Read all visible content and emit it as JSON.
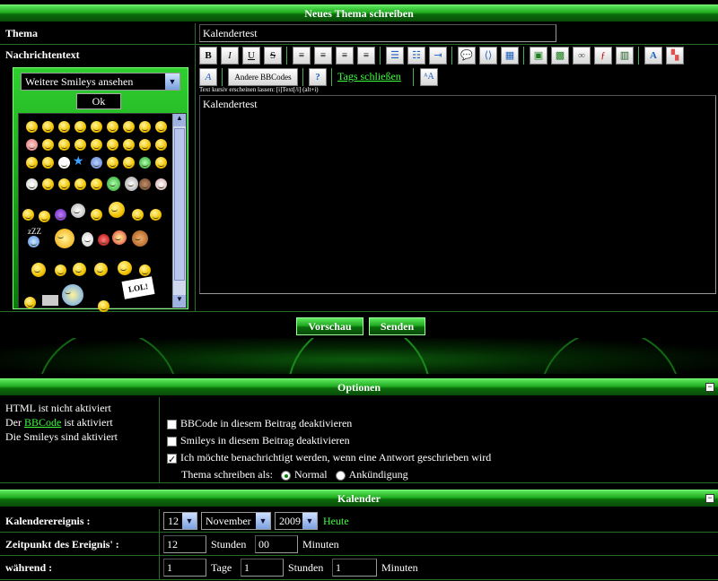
{
  "header": {
    "title": "Neues Thema schreiben"
  },
  "thema": {
    "label": "Thema",
    "value": "Kalendertest"
  },
  "message": {
    "label": "Nachrichtentext",
    "smiley_select": "Weitere Smileys ansehen",
    "ok_label": "Ok",
    "toolbar": {
      "bold": "B",
      "italic": "I",
      "underline": "U",
      "strike": "S",
      "more_bbcodes": "Andere BBCodes",
      "help": "?",
      "close_tags": "Tags schließen"
    },
    "hint": "Text kursiv erscheinen lassen: [i]Text[/i] (alt+i)",
    "body": "Kalendertest"
  },
  "actions": {
    "preview": "Vorschau",
    "send": "Senden"
  },
  "options": {
    "title": "Optionen",
    "toggle": "−",
    "html_status": "HTML ist nicht aktiviert",
    "bbcode_prefix": "Der",
    "bbcode_link": "BBCode",
    "bbcode_suffix": "ist aktiviert",
    "smileys_status": "Die Smileys sind aktiviert",
    "disable_bbcode": "BBCode in diesem Beitrag deaktivieren",
    "disable_smileys": "Smileys in diesem Beitrag deaktivieren",
    "notify": "Ich möchte benachrichtigt werden, wenn eine Antwort geschrieben wird",
    "post_as_label": "Thema schreiben als:",
    "post_as_normal": "Normal",
    "post_as_announcement": "Ankündigung"
  },
  "calendar": {
    "title": "Kalender",
    "toggle": "−",
    "event_label": "Kalenderereignis :",
    "day": "12",
    "month": "November",
    "year": "2009",
    "today": "Heute",
    "time_label": "Zeitpunkt des Ereignis' :",
    "hours_value": "12",
    "hours_label": "Stunden",
    "minutes_value": "00",
    "minutes_label": "Minuten",
    "duration_label": "während :",
    "dur_days_value": "1",
    "dur_days_label": "Tage",
    "dur_hours_value": "1",
    "dur_hours_label": "Stunden",
    "dur_minutes_value": "1",
    "dur_minutes_label": "Minuten"
  }
}
